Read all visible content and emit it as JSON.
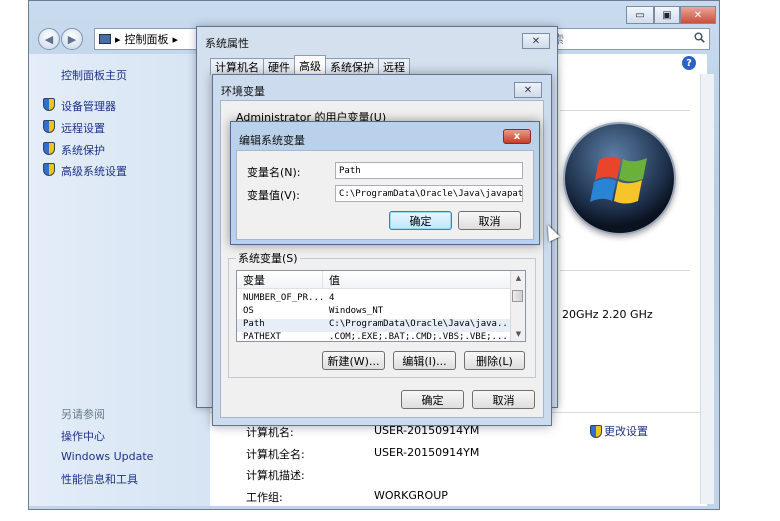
{
  "control_panel": {
    "breadcrumb": "控制面板",
    "breadcrumb_sep": "▸",
    "search_placeholder": "索",
    "window_buttons": {
      "minimize": "▭",
      "maximize": "▣",
      "close": "✕"
    },
    "left_nav": {
      "home": "控制面板主页",
      "items": [
        "设备管理器",
        "远程设置",
        "系统保护",
        "高级系统设置"
      ],
      "see_also_title": "另请参阅",
      "see_also": [
        "操作中心",
        "Windows Update",
        "性能信息和工具"
      ]
    },
    "processor_speed": "20GHz   2.20 GHz",
    "computer_info": [
      {
        "label": "计算机名:",
        "value": "USER-20150914YM"
      },
      {
        "label": "计算机全名:",
        "value": "USER-20150914YM"
      },
      {
        "label": "计算机描述:",
        "value": ""
      },
      {
        "label": "工作组:",
        "value": "WORKGROUP"
      }
    ],
    "change_settings": "更改设置",
    "help": "?"
  },
  "system_properties": {
    "title": "系统属性",
    "tabs": [
      "计算机名",
      "硬件",
      "高级",
      "系统保护",
      "远程"
    ],
    "active_tab": "高级"
  },
  "env_vars": {
    "title": "环境变量",
    "user_vars_partial": "Administrator 的用户变量(U)",
    "system_vars_label": "系统变量(S)",
    "columns": [
      "变量",
      "值"
    ],
    "rows": [
      {
        "name": "NUMBER_OF_PR...",
        "value": "4"
      },
      {
        "name": "OS",
        "value": "Windows_NT"
      },
      {
        "name": "Path",
        "value": "C:\\ProgramData\\Oracle\\Java\\java..."
      },
      {
        "name": "PATHEXT",
        "value": ".COM;.EXE;.BAT;.CMD;.VBS;.VBE;..."
      }
    ],
    "buttons": {
      "new": "新建(W)...",
      "edit": "编辑(I)...",
      "delete": "删除(L)"
    },
    "ok": "确定",
    "cancel": "取消"
  },
  "edit_var": {
    "title": "编辑系统变量",
    "name_label": "变量名(N):",
    "name_value": "Path",
    "value_label": "变量值(V):",
    "value_value": "C:\\ProgramData\\Oracle\\Java\\javapath",
    "ok": "确定",
    "cancel": "取消",
    "close": "x"
  }
}
